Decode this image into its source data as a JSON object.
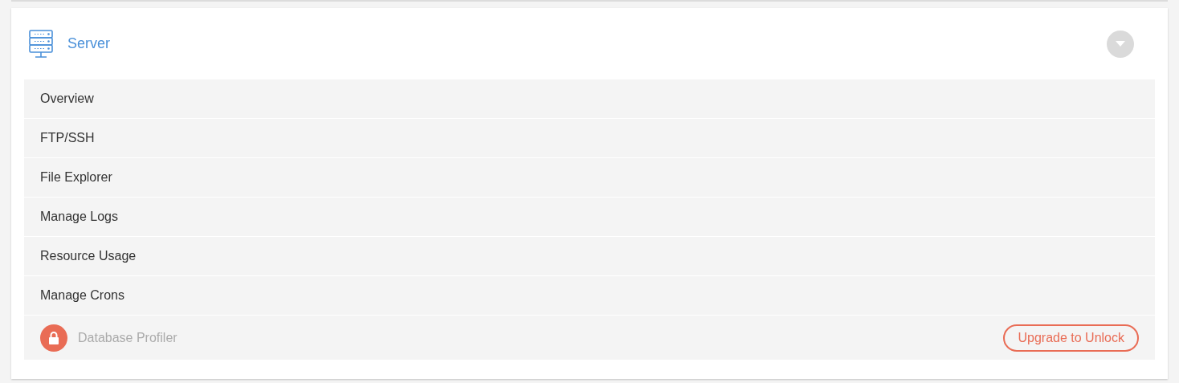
{
  "panel": {
    "title": "Server",
    "expanded": true,
    "items": [
      {
        "kind": "link",
        "label": "Overview"
      },
      {
        "kind": "link",
        "label": "FTP/SSH"
      },
      {
        "kind": "link",
        "label": "File Explorer"
      },
      {
        "kind": "link",
        "label": "Manage Logs"
      },
      {
        "kind": "link",
        "label": "Resource Usage"
      },
      {
        "kind": "link",
        "label": "Manage Crons"
      },
      {
        "kind": "locked",
        "label": "Database Profiler",
        "action": "Upgrade to Unlock"
      }
    ]
  }
}
